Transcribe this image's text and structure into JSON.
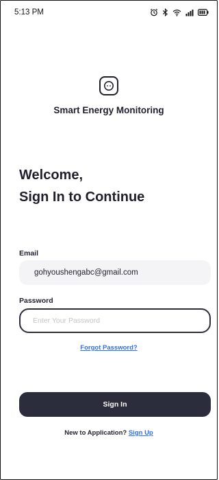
{
  "status_bar": {
    "time": "5:13 PM",
    "icons": [
      "alarm-icon",
      "bluetooth-icon",
      "wifi-icon",
      "signal-icon",
      "battery-icon"
    ]
  },
  "brand": {
    "logo_icon": "outlet-icon",
    "name": "Smart Energy Monitoring"
  },
  "welcome": {
    "line1": "Welcome,",
    "line2": "Sign In to Continue"
  },
  "email": {
    "label": "Email",
    "value": "gohyoushengabc@gmail.com"
  },
  "password": {
    "label": "Password",
    "placeholder": "Enter Your Password",
    "value": ""
  },
  "forgot_password": "Forgot Password?",
  "sign_in_label": "Sign In",
  "signup": {
    "prompt": "New to Application?",
    "link": "Sign Up"
  },
  "colors": {
    "primary_dark": "#2b2d3d",
    "link": "#2f6fe4",
    "field_bg": "#f4f4f6"
  }
}
